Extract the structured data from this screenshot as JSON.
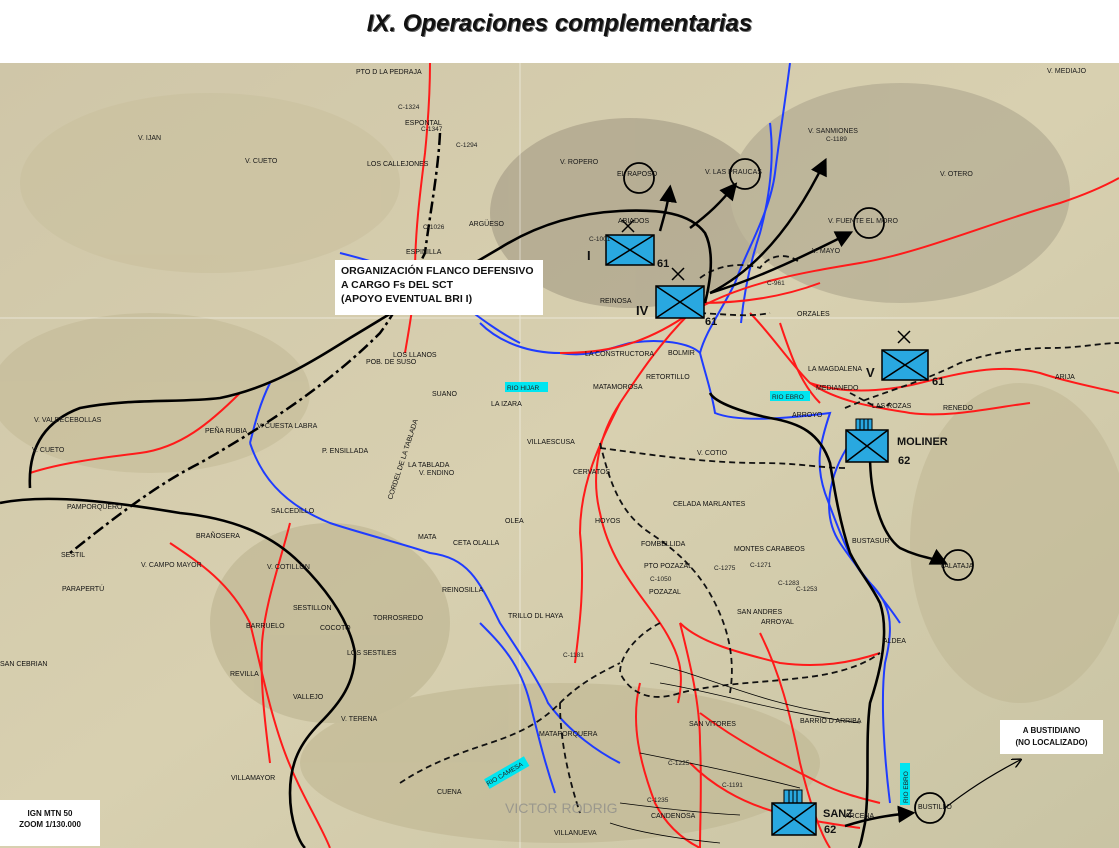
{
  "title": "IX. Operaciones complementarias",
  "callouts": {
    "flank": [
      "ORGANIZACIÓN FLANCO DEFENSIVO",
      "A CARGO Fs DEL SCT",
      "(APOYO EVENTUAL BRI I)"
    ],
    "bustidiano": [
      "A BUSTIDIANO",
      "(NO LOCALIZADO)"
    ]
  },
  "scale": [
    "IGN MTN 50",
    "ZOOM 1/130.000"
  ],
  "watermark": "VICTOR RODRIG",
  "units": [
    {
      "id": "I",
      "label": "I",
      "number": "61"
    },
    {
      "id": "IV",
      "label": "IV",
      "number": "61"
    },
    {
      "id": "V",
      "label": "V",
      "number": "61"
    },
    {
      "id": "MOLINER",
      "label": "MOLINER",
      "number": "62"
    },
    {
      "id": "SANZ",
      "label": "SANZ",
      "number": "62"
    }
  ],
  "places": [
    {
      "id": "pto-piedraja",
      "text": "PTO D LA PEDRAJA"
    },
    {
      "id": "v-mediajo",
      "text": "V. MEDIAJO"
    },
    {
      "id": "c1324",
      "text": "C-1324"
    },
    {
      "id": "espontal",
      "text": "ESPONTAL"
    },
    {
      "id": "c1347",
      "text": "C-1347"
    },
    {
      "id": "v-ijan",
      "text": "V. IJAN"
    },
    {
      "id": "c1294",
      "text": "C-1294"
    },
    {
      "id": "v-cueto-1",
      "text": "V. CUETO"
    },
    {
      "id": "callejones",
      "text": "LOS CALLEJONES"
    },
    {
      "id": "v-ropero",
      "text": "V. ROPERO"
    },
    {
      "id": "el-raposo",
      "text": "EL RAPOSO"
    },
    {
      "id": "v-las-praucas",
      "text": "V. LAS PRAUCAS"
    },
    {
      "id": "v-sanmiones",
      "text": "V. SANMIONES"
    },
    {
      "id": "c1189",
      "text": "C-1189"
    },
    {
      "id": "v-otero",
      "text": "V. OTERO"
    },
    {
      "id": "arguesito",
      "text": "ARGÜESO"
    },
    {
      "id": "c1026",
      "text": "C-1026"
    },
    {
      "id": "abiados",
      "text": "ABIADOS"
    },
    {
      "id": "c1001",
      "text": "C-1001"
    },
    {
      "id": "v-fuente-moro",
      "text": "V. FUENTE EL MORO"
    },
    {
      "id": "v-mayo",
      "text": "V. MAYO"
    },
    {
      "id": "espinilla",
      "text": "ESPINILLA"
    },
    {
      "id": "c961",
      "text": "C-961"
    },
    {
      "id": "reinosa",
      "text": "REINOSA"
    },
    {
      "id": "orzales",
      "text": "ORZALES"
    },
    {
      "id": "los-llanos",
      "text": "LOS LLANOS"
    },
    {
      "id": "pob-de-suso",
      "text": "POB. DE SUSO"
    },
    {
      "id": "la-constructora",
      "text": "LA CONSTRUCTORA"
    },
    {
      "id": "bolmir",
      "text": "BOLMIR"
    },
    {
      "id": "la-magdalena",
      "text": "LA MAGDALENA"
    },
    {
      "id": "medianedo",
      "text": "MEDIANEDO"
    },
    {
      "id": "arija",
      "text": "ARIJA"
    },
    {
      "id": "rio-hijar",
      "text": "RIO HIJAR"
    },
    {
      "id": "retortillo",
      "text": "RETORTILLO"
    },
    {
      "id": "matamorosa",
      "text": "MATAMOROSA"
    },
    {
      "id": "rio-ebro-1",
      "text": "RIO EBRO"
    },
    {
      "id": "suano",
      "text": "SUANO"
    },
    {
      "id": "la-izara",
      "text": "LA IZARA"
    },
    {
      "id": "arroyo",
      "text": "ARROYO"
    },
    {
      "id": "renedo",
      "text": "RENEDO"
    },
    {
      "id": "las-rozas",
      "text": "LAS ROZAS"
    },
    {
      "id": "v-valdecebollas",
      "text": "V. VALDECEBOLLAS"
    },
    {
      "id": "pena-rubia",
      "text": "PEÑA RUBIA"
    },
    {
      "id": "v-cuesta-labra",
      "text": "V. CUESTA LABRA"
    },
    {
      "id": "villaescusa",
      "text": "VILLAESCUSA"
    },
    {
      "id": "v-cueto-2",
      "text": "V. CUETO"
    },
    {
      "id": "p-ensillada",
      "text": "P. ENSILLADA"
    },
    {
      "id": "cordel",
      "text": "CORDEL DE LA TABLADA"
    },
    {
      "id": "la-tablada",
      "text": "LA TABLADA"
    },
    {
      "id": "v-endino",
      "text": "V. ENDINO"
    },
    {
      "id": "cervatos",
      "text": "CERVATOS"
    },
    {
      "id": "v-cotio",
      "text": "V. COTIO"
    },
    {
      "id": "pamporquero",
      "text": "PAMPORQUERO"
    },
    {
      "id": "salcedillo",
      "text": "SALCEDILLO"
    },
    {
      "id": "celada",
      "text": "CELADA MARLANTES"
    },
    {
      "id": "olea",
      "text": "OLEA"
    },
    {
      "id": "hoyos",
      "text": "HOYOS"
    },
    {
      "id": "branosera",
      "text": "BRAÑOSERA"
    },
    {
      "id": "mata",
      "text": "MATA"
    },
    {
      "id": "ceta-olalla",
      "text": "CETA OLALLA"
    },
    {
      "id": "fombellida",
      "text": "FOMBELLIDA"
    },
    {
      "id": "bustasur",
      "text": "BUSTASUR"
    },
    {
      "id": "sestil",
      "text": "SESTIL"
    },
    {
      "id": "montes-carabeos",
      "text": "MONTES CARABEOS"
    },
    {
      "id": "v-campo-mayor",
      "text": "V. CAMPO MAYOR"
    },
    {
      "id": "v-cotillon",
      "text": "V. COTILLON"
    },
    {
      "id": "pto-pozazal",
      "text": "PTO POZAZAL"
    },
    {
      "id": "c1275",
      "text": "C-1275"
    },
    {
      "id": "c1271",
      "text": "C-1271"
    },
    {
      "id": "c1050",
      "text": "C-1050"
    },
    {
      "id": "c1283",
      "text": "C-1283"
    },
    {
      "id": "c1253",
      "text": "C-1253"
    },
    {
      "id": "valataja",
      "text": "VALATAJA"
    },
    {
      "id": "parapertu",
      "text": "PARAPERTÚ"
    },
    {
      "id": "pozazal",
      "text": "POZAZAL"
    },
    {
      "id": "reinosilla",
      "text": "REINOSILLA"
    },
    {
      "id": "sestillon",
      "text": "SESTILLON"
    },
    {
      "id": "torrosredo",
      "text": "TORROSREDO"
    },
    {
      "id": "trillo-haya",
      "text": "TRILLO DL HAYA"
    },
    {
      "id": "san-andres",
      "text": "SAN ANDRES"
    },
    {
      "id": "barruelo",
      "text": "BARRUELO"
    },
    {
      "id": "cocoto",
      "text": "COCOTO"
    },
    {
      "id": "arroyal",
      "text": "ARROYAL"
    },
    {
      "id": "aldea",
      "text": "ALDEA"
    },
    {
      "id": "san-cebrian",
      "text": "SAN CEBRIAN"
    },
    {
      "id": "los-sestiles",
      "text": "LOS SESTILES"
    },
    {
      "id": "c1181",
      "text": "C-1181"
    },
    {
      "id": "revilla",
      "text": "REVILLA"
    },
    {
      "id": "vallejo",
      "text": "VALLEJO"
    },
    {
      "id": "v-terena",
      "text": "V. TERENA"
    },
    {
      "id": "san-vitores",
      "text": "SAN VITORES"
    },
    {
      "id": "barrio-arriba",
      "text": "BARRIO D ARRIBA"
    },
    {
      "id": "mataporquera",
      "text": "MATAPORQUERA"
    },
    {
      "id": "c1225",
      "text": "C-1225"
    },
    {
      "id": "rio-camesa",
      "text": "RIO CAMESA"
    },
    {
      "id": "villamayor",
      "text": "VILLAMAYOR"
    },
    {
      "id": "c1191",
      "text": "C-1191"
    },
    {
      "id": "rio-ebro-2",
      "text": "RIO EBRO"
    },
    {
      "id": "c1235",
      "text": "C-1235"
    },
    {
      "id": "cuena",
      "text": "CUENA"
    },
    {
      "id": "candenosa",
      "text": "CANDENOSA"
    },
    {
      "id": "arcena",
      "text": "ARCENA"
    },
    {
      "id": "bustillo",
      "text": "BUSTILLO"
    },
    {
      "id": "villanueva",
      "text": "VILLANUEVA"
    }
  ]
}
